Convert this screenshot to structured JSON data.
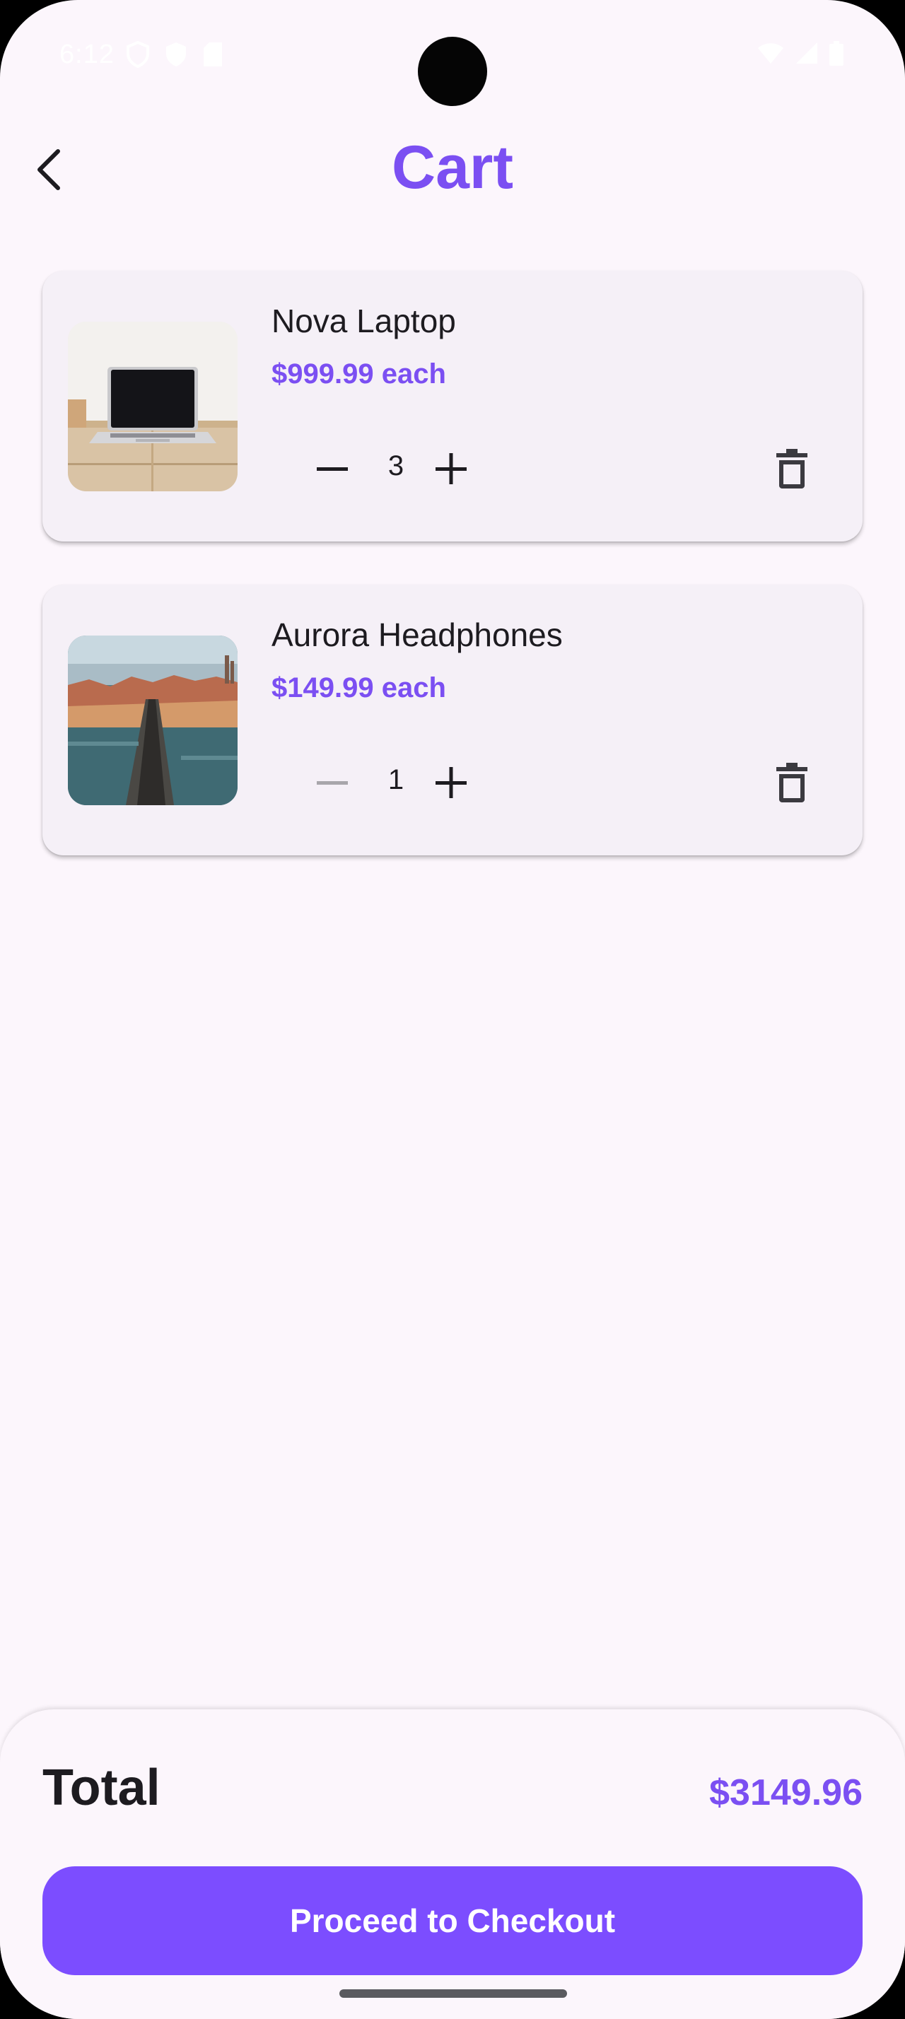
{
  "status_bar": {
    "time": "6:12",
    "icons_left": [
      "vpn-shield-icon",
      "security-shield-icon",
      "sd-card-icon"
    ],
    "icons_right": [
      "wifi-icon",
      "cell-signal-icon",
      "battery-icon"
    ]
  },
  "header": {
    "title": "Cart",
    "back_icon": "chevron-left-icon"
  },
  "cart": {
    "items": [
      {
        "name": "Nova Laptop",
        "price": "$999.99 each",
        "quantity": "3",
        "image": "laptop-photo",
        "decrement_enabled": true
      },
      {
        "name": "Aurora Headphones",
        "price": "$149.99 each",
        "quantity": "1",
        "image": "city-bridge-photo",
        "decrement_enabled": false
      }
    ]
  },
  "summary": {
    "total_label": "Total",
    "total_value": "$3149.96",
    "checkout_label": "Proceed to Checkout"
  },
  "colors": {
    "accent": "#7b4ff2",
    "button": "#7c4dff",
    "background": "#fcf6fc",
    "card": "#f5f0f7",
    "text": "#1d1b20"
  }
}
